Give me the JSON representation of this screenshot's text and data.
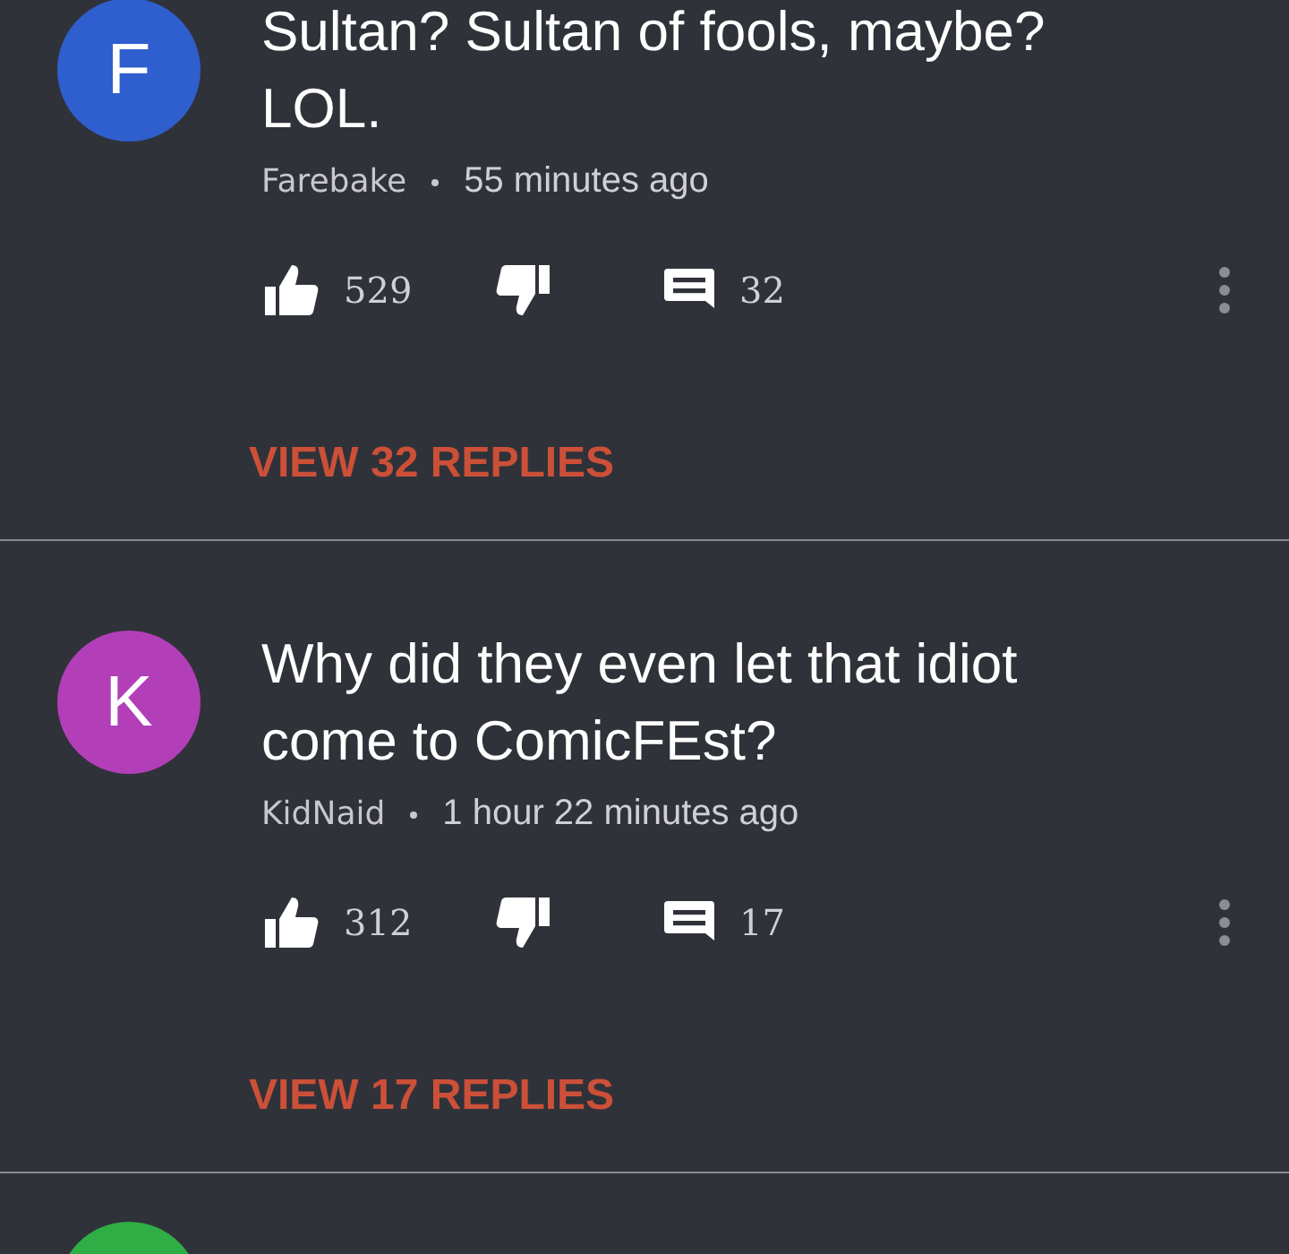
{
  "comments": [
    {
      "avatar_letter": "F",
      "color": "#2f5fce",
      "text": "Sultan? Sultan of fools, maybe? LOL.",
      "author": "Farebake",
      "time": "55 minutes ago",
      "likes": "529",
      "reply_count": "32",
      "view_replies": "VIEW 32 REPLIES"
    },
    {
      "avatar_letter": "K",
      "color": "#b23fb8",
      "text": "Why did they even let that idiot come to ComicFEst?",
      "author": "KidNaid",
      "time": "1 hour 22 minutes ago",
      "likes": "312",
      "reply_count": "17",
      "view_replies": "VIEW 17 REPLIES"
    },
    {
      "color": "#2fae45"
    }
  ]
}
